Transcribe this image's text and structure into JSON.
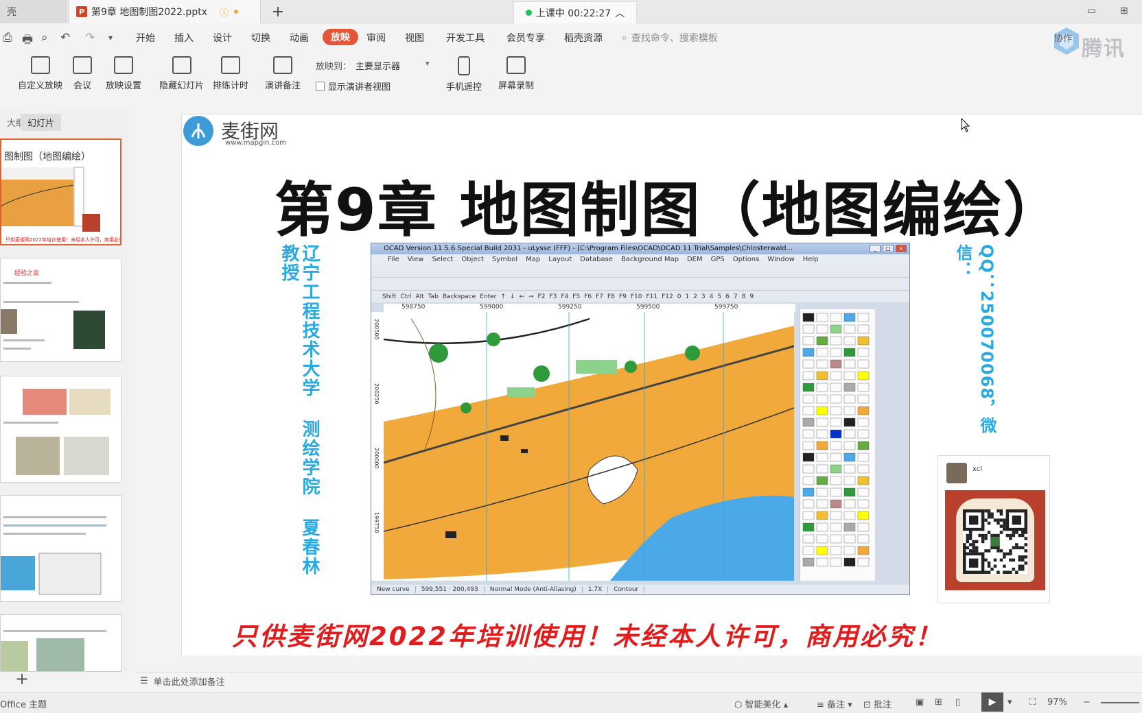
{
  "titlebar": {
    "left_tab_label": "壳",
    "active_tab_label": "第9章 地图制图2022.pptx",
    "live_status": "上课中 00:22:27"
  },
  "quick_access": {
    "icons": [
      "save-icon",
      "print-icon",
      "preview-icon",
      "undo-icon",
      "redo-icon",
      "dropdown-icon"
    ]
  },
  "menu": {
    "items": [
      "开始",
      "插入",
      "设计",
      "切换",
      "动画",
      "放映",
      "审阅",
      "视图",
      "开发工具",
      "会员专享",
      "稻壳资源"
    ],
    "active": "放映",
    "search_placeholder": "查找命令、搜索模板",
    "share_label": "协作",
    "watermark_text": "腾讯"
  },
  "ribbon": {
    "buttons": [
      {
        "label": "自定义放映",
        "icon": "custom-show-icon"
      },
      {
        "label": "会议",
        "icon": "meeting-icon"
      },
      {
        "label": "放映设置",
        "icon": "show-settings-icon"
      },
      {
        "label": "隐藏幻灯片",
        "icon": "hide-slide-icon"
      },
      {
        "label": "排练计时",
        "icon": "rehearse-timing-icon"
      },
      {
        "label": "演讲备注",
        "icon": "speaker-notes-icon"
      },
      {
        "label": "手机遥控",
        "icon": "phone-remote-icon"
      },
      {
        "label": "屏幕录制",
        "icon": "screen-record-icon"
      }
    ],
    "show_on_label": "放映到：",
    "show_on_value": "主要显示器",
    "presenter_view_label": "显示演讲者视图"
  },
  "left_panel": {
    "tab_outline": "大纲",
    "tab_slides": "幻灯片",
    "first_thumb_title": "图制图（地图编绘）",
    "thumb_caption_2": "经验之谈"
  },
  "slide": {
    "brand_name": "麦街网",
    "brand_url": "www.mapgin.com",
    "title": "第9章  地图制图（地图编绘）",
    "vertical_left": "辽宁工程技术大学 测绘学院 夏春林 教授",
    "vertical_right": "QQ：250070068，微信：",
    "footer": "只供麦街网2022年培训使用！未经本人许可，商用必究！",
    "qr_name": "xcl"
  },
  "ocad": {
    "title": "OCAD Version 11.5.6  Special Build 2031   -  uLysse (FFF) - [C:\\Program Files\\OCAD\\OCAD 11 Trial\\Samples\\Chlosterwald...",
    "menu": [
      "File",
      "View",
      "Select",
      "Object",
      "Symbol",
      "Map",
      "Layout",
      "Database",
      "Background Map",
      "DEM",
      "GPS",
      "Options",
      "Window",
      "Help"
    ],
    "keys": [
      "Shift",
      "Ctrl",
      "Alt",
      "Tab",
      "Backspace",
      "Enter",
      "↑",
      "↓",
      "←",
      "→",
      "F2",
      "F3",
      "F4",
      "F5",
      "F6",
      "F7",
      "F8",
      "F9",
      "F10",
      "F11",
      "F12",
      "0",
      "1",
      "2",
      "3",
      "4",
      "5",
      "6",
      "7",
      "8",
      "9"
    ],
    "ruler": [
      "598750",
      "599000",
      "599250",
      "599500",
      "599750"
    ],
    "vruler": [
      "200500",
      "200250",
      "200000",
      "199750"
    ],
    "status": [
      "New curve",
      "599,551 · 200,493",
      "Normal Mode (Anti-Aliasing)",
      "1.7X",
      "Contour"
    ]
  },
  "notes": {
    "placeholder": "单击此处添加备注"
  },
  "statusbar": {
    "theme": "Office 主题",
    "beautify": "智能美化",
    "notes": "备注",
    "comments": "批注",
    "zoom": "97%"
  }
}
